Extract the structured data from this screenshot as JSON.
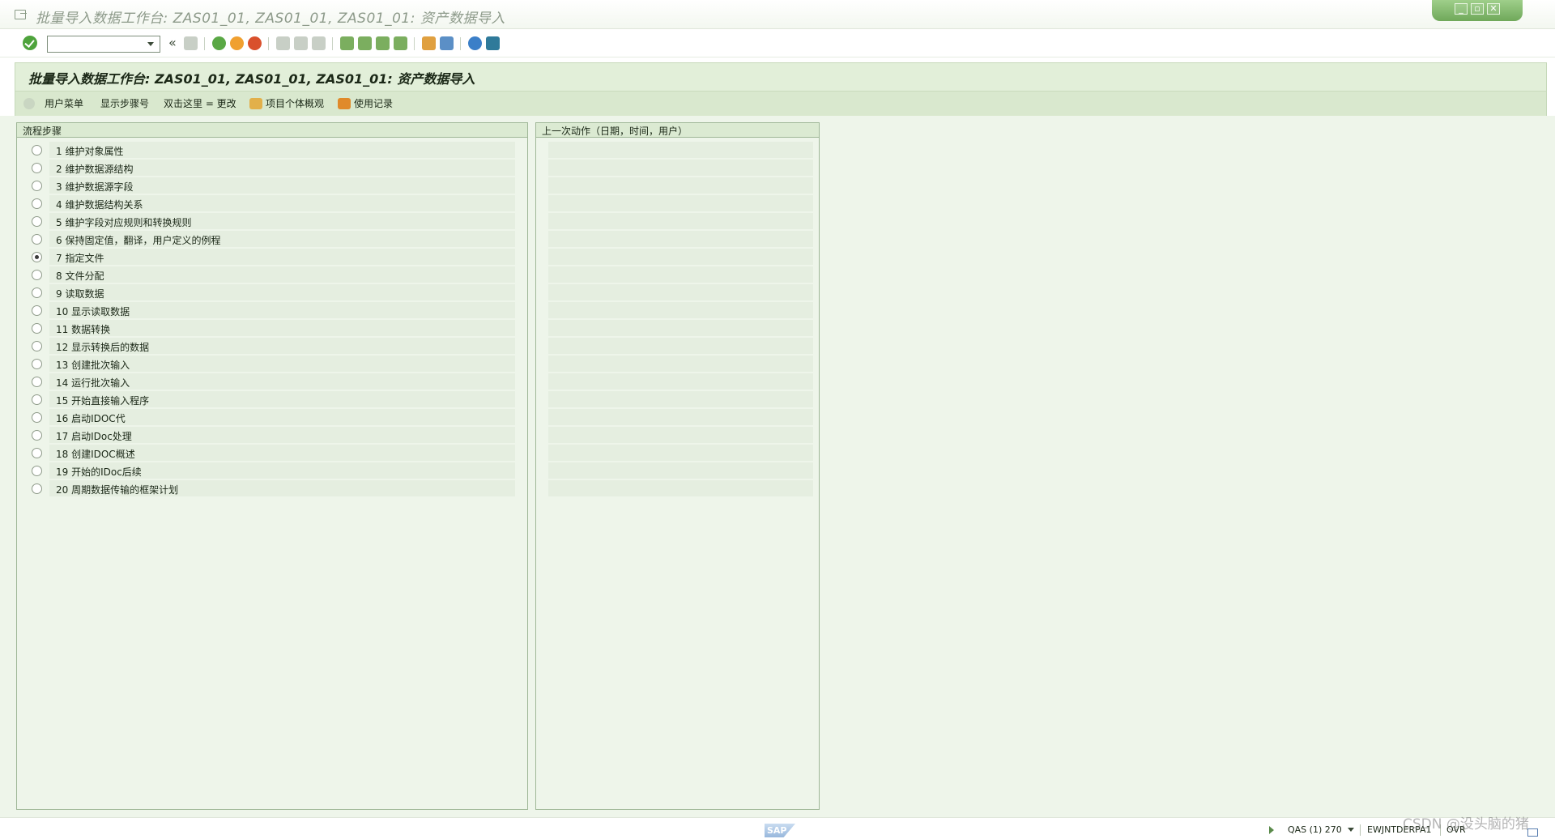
{
  "window": {
    "title": "批量导入数据工作台: ZAS01_01, ZAS01_01, ZAS01_01: 资产数据导入",
    "controls": [
      "_",
      "▫",
      "✕"
    ]
  },
  "toolbar": {
    "command_value": "",
    "back_label": "«"
  },
  "page": {
    "title": "批量导入数据工作台: ZAS01_01, ZAS01_01, ZAS01_01: 资产数据导入"
  },
  "app_toolbar": {
    "user_menu": "用户菜单",
    "show_step_no": "显示步骤号",
    "double_click_change": "双击这里 = 更改",
    "project_overview": "项目个体概观",
    "usage_log": "使用记录"
  },
  "steps_panel": {
    "header": "流程步骤",
    "selected_index": 6,
    "items": [
      "1 维护对象属性",
      "2 维护数据源结构",
      "3 维护数据源字段",
      "4 维护数据结构关系",
      "5 维护字段对应规则和转换规则",
      "6 保持固定值，翻译，用户定义的例程",
      "7 指定文件",
      "8 文件分配",
      "9 读取数据",
      "10 显示读取数据",
      "11 数据转换",
      "12 显示转换后的数据",
      "13 创建批次输入",
      "14 运行批次输入",
      "15 开始直接输入程序",
      "16 启动IDOC代",
      "17 启动IDoc处理",
      "18 创建IDOC概述",
      "19 开始的IDoc后续",
      "20 周期数据传输的框架计划"
    ]
  },
  "last_action_panel": {
    "header": "上一次动作（日期，时间，用户）",
    "row_count": 20
  },
  "status": {
    "logo": "SAP",
    "system": "QAS (1) 270",
    "server": "EWJNTDERPA1",
    "mode": "OVR"
  },
  "watermark": "CSDN @没头脑的猪"
}
